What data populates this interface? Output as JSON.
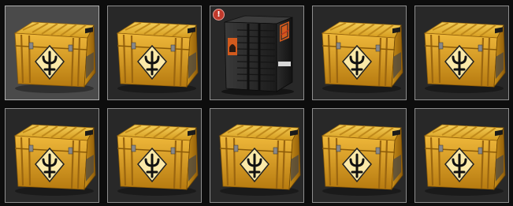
{
  "inventory": {
    "slots": [
      {
        "item": "gold-weapon-case",
        "selected": true,
        "alert": false
      },
      {
        "item": "gold-weapon-case",
        "selected": false,
        "alert": false
      },
      {
        "item": "black-case",
        "selected": false,
        "alert": true,
        "alert_text": "!"
      },
      {
        "item": "gold-weapon-case",
        "selected": false,
        "alert": false
      },
      {
        "item": "gold-weapon-case",
        "selected": false,
        "alert": false
      },
      {
        "item": "gold-weapon-case",
        "selected": false,
        "alert": false
      },
      {
        "item": "gold-weapon-case",
        "selected": false,
        "alert": false
      },
      {
        "item": "gold-weapon-case",
        "selected": false,
        "alert": false
      },
      {
        "item": "gold-weapon-case",
        "selected": false,
        "alert": false
      },
      {
        "item": "gold-weapon-case",
        "selected": false,
        "alert": false
      }
    ]
  },
  "colors": {
    "slot_background": "#282828",
    "selected_background": "#4a4a4a",
    "slot_border": "#8e8e8e",
    "alert_badge": "#c0392b",
    "case_gold": "#e0a829",
    "case_black": "#2a2a2a"
  }
}
